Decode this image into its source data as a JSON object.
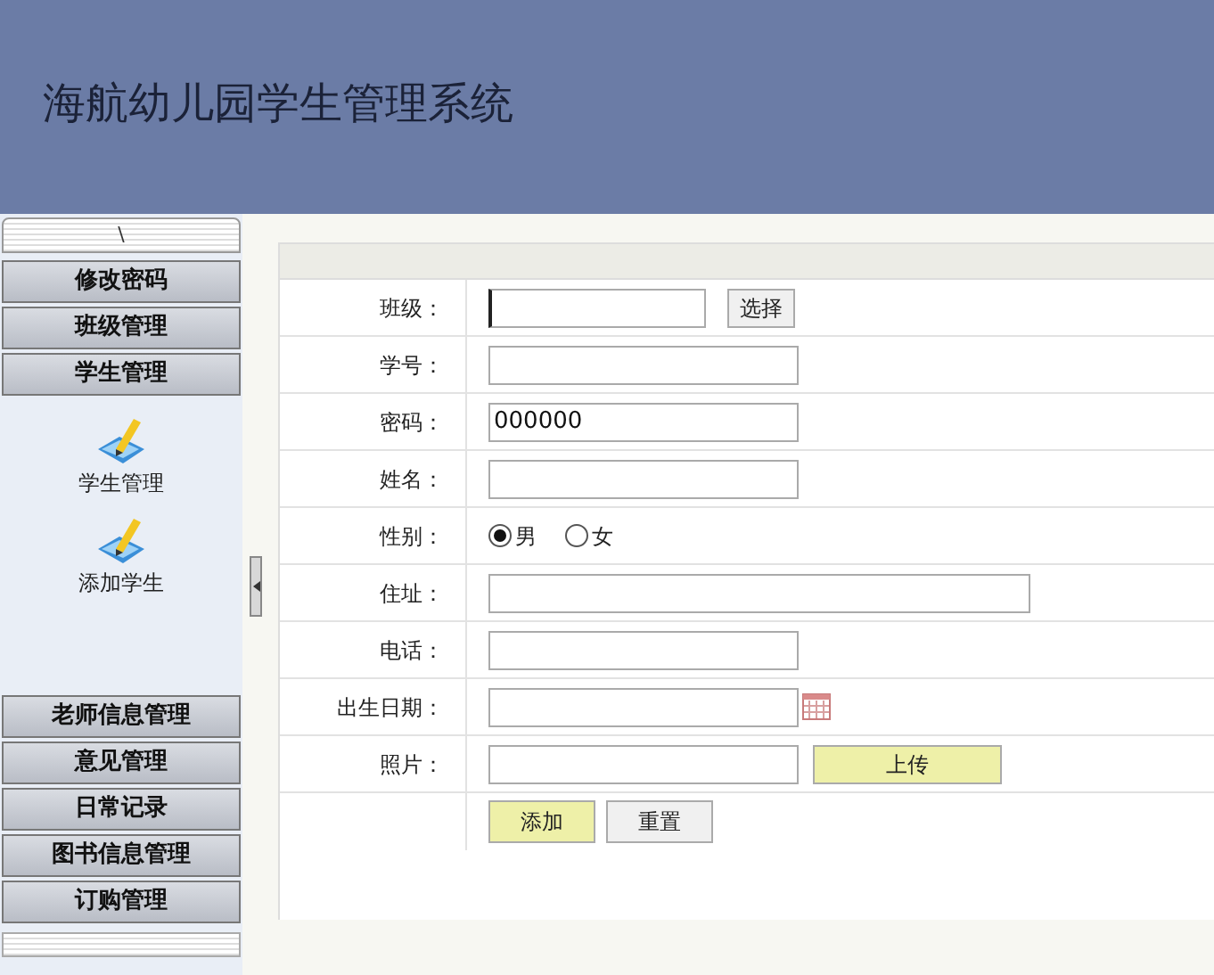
{
  "header": {
    "title": "海航幼儿园学生管理系统"
  },
  "sidebar": {
    "toggle": "\\",
    "menus": [
      {
        "label": "修改密码"
      },
      {
        "label": "班级管理"
      },
      {
        "label": "学生管理",
        "children": [
          {
            "label": "学生管理"
          },
          {
            "label": "添加学生"
          }
        ]
      },
      {
        "label": "老师信息管理"
      },
      {
        "label": "意见管理"
      },
      {
        "label": "日常记录"
      },
      {
        "label": "图书信息管理"
      },
      {
        "label": "订购管理"
      }
    ]
  },
  "form": {
    "rows": [
      {
        "kind": "select",
        "label": "班级：",
        "value": "",
        "button": "选择",
        "focused": true
      },
      {
        "kind": "text",
        "label": "学号：",
        "value": ""
      },
      {
        "kind": "text",
        "label": "密码：",
        "value": "000000"
      },
      {
        "kind": "text",
        "label": "姓名：",
        "value": ""
      },
      {
        "kind": "radio",
        "label": "性别：",
        "options": [
          {
            "label": "男",
            "selected": true
          },
          {
            "label": "女",
            "selected": false
          }
        ]
      },
      {
        "kind": "wide",
        "label": "住址：",
        "value": ""
      },
      {
        "kind": "text",
        "label": "电话：",
        "value": ""
      },
      {
        "kind": "date",
        "label": "出生日期：",
        "value": ""
      },
      {
        "kind": "upload",
        "label": "照片：",
        "value": "",
        "button": "上传"
      }
    ],
    "buttons": [
      {
        "label": "添加",
        "kind": "primary"
      },
      {
        "label": "重置",
        "kind": "secondary"
      }
    ]
  }
}
